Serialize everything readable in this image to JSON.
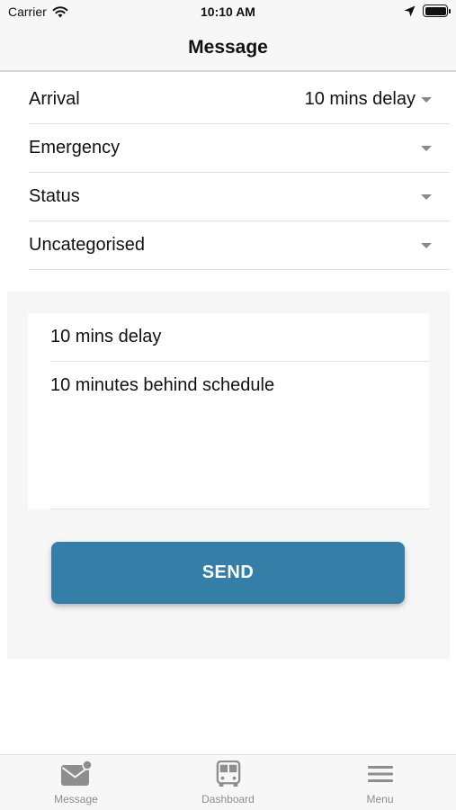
{
  "status_bar": {
    "carrier": "Carrier",
    "time": "10:10 AM"
  },
  "nav": {
    "title": "Message"
  },
  "dropdowns": [
    {
      "label": "Arrival",
      "value": "10 mins delay"
    },
    {
      "label": "Emergency",
      "value": ""
    },
    {
      "label": "Status",
      "value": ""
    },
    {
      "label": "Uncategorised",
      "value": ""
    }
  ],
  "message": {
    "subject": "10 mins delay",
    "body": "10 minutes behind schedule",
    "send_label": "SEND"
  },
  "tab_bar": {
    "items": [
      {
        "label": "Message",
        "icon": "message-icon"
      },
      {
        "label": "Dashboard",
        "icon": "bus-icon"
      },
      {
        "label": "Menu",
        "icon": "hamburger-menu-icon"
      }
    ]
  },
  "colors": {
    "accent": "#357ea8",
    "tab_inactive": "#8e8e8e",
    "bar_background": "#f7f7f7"
  }
}
